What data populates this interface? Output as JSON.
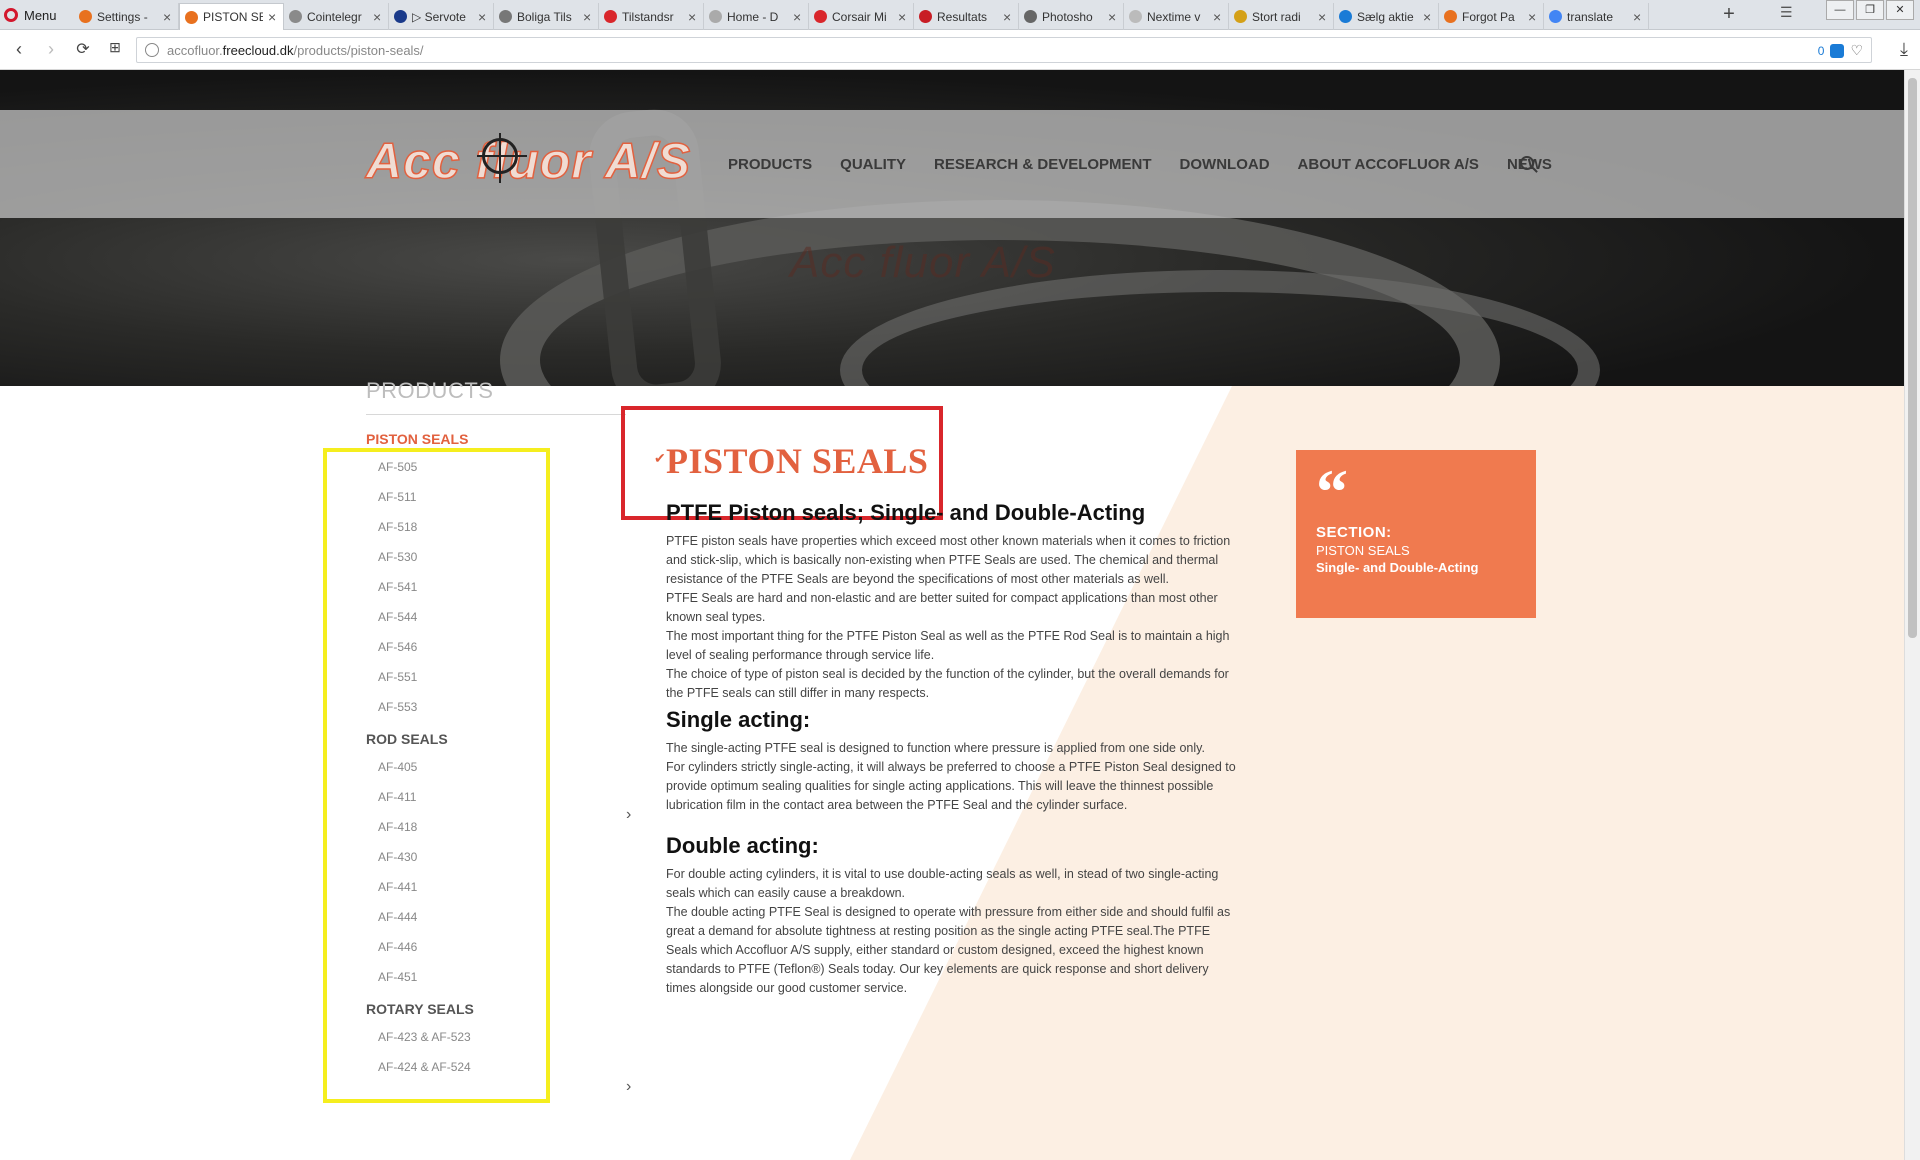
{
  "browser": {
    "menu_label": "Menu",
    "tabs": [
      {
        "title": "Settings -",
        "color": "#e8711f"
      },
      {
        "title": "PISTON SE",
        "color": "#e8711f",
        "active": true
      },
      {
        "title": "Cointelegr",
        "color": "#8a8a8a"
      },
      {
        "title": "▷ Servote",
        "color": "#1a3a8a"
      },
      {
        "title": "Boliga Tils",
        "color": "#777777"
      },
      {
        "title": "Tilstandsr",
        "color": "#d9262b"
      },
      {
        "title": "Home - D",
        "color": "#aaaaaa"
      },
      {
        "title": "Corsair Mi",
        "color": "#d9262b"
      },
      {
        "title": "Resultats",
        "color": "#c81d25"
      },
      {
        "title": "Photosho",
        "color": "#666666"
      },
      {
        "title": "Nextime v",
        "color": "#bbbbbb"
      },
      {
        "title": "Stort radi",
        "color": "#d4a017"
      },
      {
        "title": "Sælg aktie",
        "color": "#1a7bd6"
      },
      {
        "title": "Forgot Pa",
        "color": "#e8711f"
      },
      {
        "title": "translate",
        "color": "#4285f4"
      }
    ],
    "url_prefix": "accofluor.",
    "url_domain": "freecloud.dk",
    "url_path": "/products/piston-seals/",
    "adblock_count": "0"
  },
  "header": {
    "logo_text": "Acc  fluor A/S",
    "nav": [
      "PRODUCTS",
      "QUALITY",
      "RESEARCH & DEVELOPMENT",
      "DOWNLOAD",
      "ABOUT ACCOFLUOR A/S",
      "NEWS"
    ],
    "hero_watermark": "Acc fluor A/S"
  },
  "sidebar": {
    "title": "PRODUCTS",
    "piston_label": "PISTON SEALS",
    "piston_items": [
      "AF-505",
      "AF-511",
      "AF-518",
      "AF-530",
      "AF-541",
      "AF-544",
      "AF-546",
      "AF-551",
      "AF-553"
    ],
    "rod_label": "ROD SEALS",
    "rod_items": [
      "AF-405",
      "AF-411",
      "AF-418",
      "AF-430",
      "AF-441",
      "AF-444",
      "AF-446",
      "AF-451"
    ],
    "rotary_label": "ROTARY SEALS",
    "rotary_items": [
      "AF-423 & AF-523",
      "AF-424 & AF-524"
    ]
  },
  "main": {
    "title": "PISTON SEALS",
    "subtitle": "PTFE Piston seals; Single- and Double-Acting",
    "intro": [
      "PTFE piston seals have properties which exceed most other known materials when it comes to friction and stick-slip, which is basically non-existing when PTFE Seals are used. The chemical and thermal resistance of the PTFE Seals are beyond the specifications of most other materials as well.",
      "PTFE Seals are hard and non-elastic and are better suited for compact applications than most other known seal types.",
      "The most important thing for the PTFE Piston Seal as well as the PTFE Rod Seal is to maintain a high level of sealing performance through service life.",
      "The choice of type of piston seal is decided by the function of the cylinder, but the overall demands for the PTFE seals can still differ in many respects."
    ],
    "single_heading": "Single acting:",
    "single": [
      "The single-acting PTFE seal is designed to function where pressure is applied from one side only.",
      "For cylinders strictly single-acting, it will always be preferred to choose a PTFE Piston Seal designed to provide optimum sealing qualities for single acting applications. This will leave the thinnest possible lubrication film in the contact area between the PTFE Seal and the cylinder surface."
    ],
    "double_heading": "Double acting:",
    "double": [
      "For double acting cylinders, it is vital to use double-acting seals as well, in stead of two single-acting seals which can easily cause a breakdown.",
      "The double acting PTFE Seal is designed to operate with pressure from either side and should fulfil as great a demand for absolute tightness at resting position as the single acting PTFE seal.The PTFE Seals which Accofluor A/S supply, either standard or custom designed, exceed the highest known standards to PTFE (Teflon®) Seals today. Our key elements are quick response and short delivery times alongside our good customer service."
    ]
  },
  "section_box": {
    "quote": "“",
    "label": "SECTION:",
    "line1": "PISTON SEALS",
    "line2": "Single- and Double-Acting"
  },
  "colors": {
    "accent": "#e2613f",
    "box": "#f07a4f",
    "peach": "#fcefe3",
    "annotation_yellow": "#f5ee1e",
    "annotation_red": "#d9262b"
  }
}
